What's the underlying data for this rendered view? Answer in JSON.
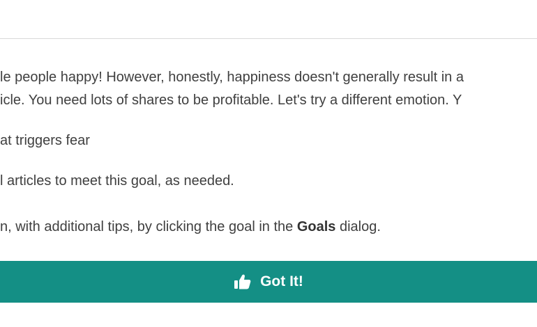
{
  "message": {
    "line_1": "le people happy! However, honestly, happiness doesn't generally result in a",
    "line_2": "icle. You need lots of shares to be profitable. Let's try a different emotion. Y",
    "line_3": "at triggers fear",
    "line_4": "l articles to meet this goal, as needed.",
    "line_5_before": "n, with additional tips, by clicking the goal in the ",
    "line_5_bold": "Goals",
    "line_5_after": " dialog."
  },
  "button": {
    "icon": "thumbs-up-icon",
    "label": "Got It!",
    "color": "#148f85"
  }
}
